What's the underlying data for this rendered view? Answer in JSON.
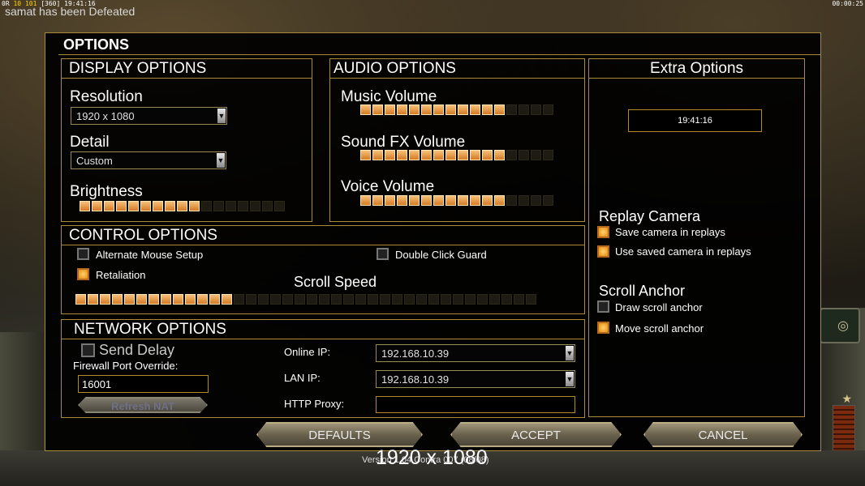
{
  "hud": {
    "top_left_a": "0R",
    "top_left_b": "10",
    "top_left_c": "101",
    "top_left_d": "[360]",
    "top_left_time": "19:41:16",
    "top_right_time": "00:00:25",
    "defeat_message": "samat has been Defeated"
  },
  "options": {
    "title": "OPTIONS",
    "display": {
      "header": "DISPLAY OPTIONS",
      "resolution_label": "Resolution",
      "resolution_value": "1920 x 1080",
      "detail_label": "Detail",
      "detail_value": "Custom",
      "brightness_label": "Brightness",
      "brightness_level": 0.6
    },
    "audio": {
      "header": "AUDIO OPTIONS",
      "music_label": "Music Volume",
      "music_level": 0.75,
      "sfx_label": "Sound FX Volume",
      "sfx_level": 0.75,
      "voice_label": "Voice Volume",
      "voice_level": 0.75
    },
    "extra": {
      "header": "Extra Options",
      "clock": "19:41:16",
      "replay_camera_label": "Replay Camera",
      "save_camera_label": "Save camera in replays",
      "save_camera_checked": true,
      "use_saved_camera_label": "Use saved camera in replays",
      "use_saved_camera_checked": true,
      "scroll_anchor_label": "Scroll Anchor",
      "draw_anchor_label": "Draw scroll anchor",
      "draw_anchor_checked": false,
      "move_anchor_label": "Move scroll anchor",
      "move_anchor_checked": true
    },
    "control": {
      "header": "CONTROL OPTIONS",
      "alt_mouse_label": "Alternate Mouse Setup",
      "alt_mouse_checked": false,
      "double_click_label": "Double Click Guard",
      "double_click_checked": false,
      "retaliation_label": "Retaliation",
      "retaliation_checked": true,
      "scroll_speed_label": "Scroll Speed",
      "scroll_speed_level": 0.35
    },
    "network": {
      "header": "NETWORK OPTIONS",
      "send_delay_label": "Send Delay",
      "send_delay_checked": false,
      "firewall_label": "Firewall Port Override:",
      "firewall_value": "16001",
      "refresh_nat_label": "Refresh NAT",
      "online_ip_label": "Online IP:",
      "online_ip_value": "192.168.10.39",
      "lan_ip_label": "LAN IP:",
      "lan_ip_value": "192.168.10.39",
      "http_proxy_label": "HTTP Proxy:",
      "http_proxy_value": ""
    },
    "buttons": {
      "defaults": "DEFAULTS",
      "accept": "ACCEPT",
      "cancel": "CANCEL"
    },
    "version_text": "Version 1.04 Contra 007 (08/08)",
    "overlay_resolution": "1920 x 1080"
  }
}
